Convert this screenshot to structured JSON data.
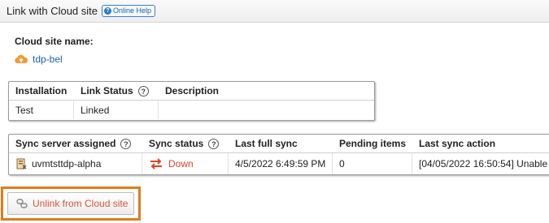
{
  "header": {
    "title": "Link with Cloud site",
    "help_label": "Online Help"
  },
  "cloud_site": {
    "label": "Cloud site name:",
    "name": "tdp-bel"
  },
  "installation_table": {
    "headers": [
      "Installation",
      "Link Status",
      "Description"
    ],
    "rows": [
      [
        "Test",
        "Linked",
        ""
      ]
    ]
  },
  "sync_table": {
    "headers": [
      "Sync server assigned",
      "Sync status",
      "Last full sync",
      "Pending items",
      "Last sync action"
    ],
    "rows": [
      {
        "server": "uvmtsttdp-alpha",
        "status": "Down",
        "last_full_sync": "4/5/2022 6:49:59 PM",
        "pending": "0",
        "last_action": "[04/05/2022 16:50:54] Unable"
      }
    ]
  },
  "actions": {
    "unlink_label": "Unlink from Cloud site"
  },
  "colors": {
    "link": "#1a65b0",
    "status_down": "#e0442a",
    "highlight": "#e27b1b",
    "cloud_icon": "#f39a2e"
  }
}
